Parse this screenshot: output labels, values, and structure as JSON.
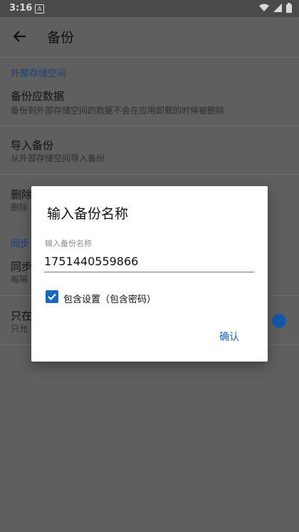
{
  "status_bar": {
    "time": "3:16",
    "notification_letter": "A"
  },
  "app_bar": {
    "title": "备份"
  },
  "sections": [
    {
      "header": "外部存储空间",
      "items": [
        {
          "title": "备份应数据",
          "summary": "备份到外部存储空间的数据不会在应用卸载的时候被删除"
        },
        {
          "title": "导入备份",
          "summary": "从外部存储空间导入备份"
        },
        {
          "title": "删除",
          "summary": "删除"
        }
      ]
    },
    {
      "header": "同步",
      "items": [
        {
          "title": "同步",
          "summary": "每隔"
        },
        {
          "title": "只在",
          "summary": "只允"
        }
      ]
    }
  ],
  "dialog": {
    "title": "输入备份名称",
    "field_label": "输入备份名称",
    "field_value": "1751440559866",
    "checkbox_label": "包含设置（包含密码）",
    "checkbox_checked": true,
    "confirm_label": "确认"
  },
  "colors": {
    "accent": "#1a65c0",
    "scrim_background": "#5f5f5f",
    "dialog_background": "#ffffff"
  }
}
